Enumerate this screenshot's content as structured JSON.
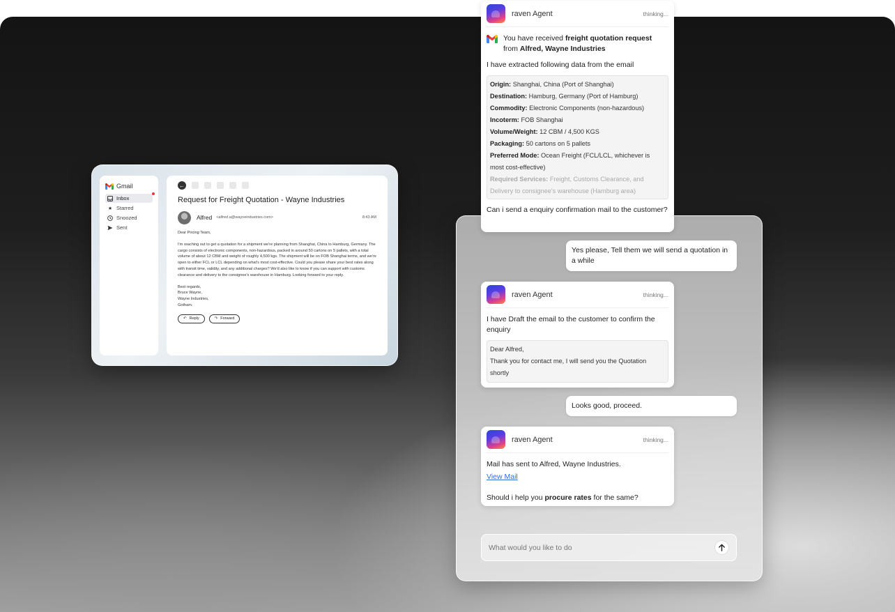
{
  "gmail": {
    "brand": "Gmail",
    "nav": [
      {
        "label": "Inbox",
        "icon": "inbox-icon"
      },
      {
        "label": "Starred",
        "icon": "star-icon"
      },
      {
        "label": "Snoozed",
        "icon": "clock-icon"
      },
      {
        "label": "Sent",
        "icon": "send-icon"
      }
    ],
    "subject": "Request for Freight Quotation - Wayne Industries",
    "sender_name": "Alfred",
    "sender_email": "<alfred.a@wayneindustries.com>",
    "time": "8:43 AM",
    "greeting": "Dear Pricing Team,",
    "body": "I'm reaching out to get a quotation for a shipment we're planning from Shanghai, China to Hamburg, Germany. The cargo consists of electronic components, non-hazardous, packed in around 50 cartons on 5 pallets, with a total volume of about 12 CBM and weight of roughly 4,500 kgs. The shipment will be on FOB Shanghai terms, and we're open to either FCL or LCL depending on what's most cost-effective. Could you please share your best rates along with transit time, validity, and any additional charges? We'd also like to know if you can support with customs clearance and delivery to the consignee's warehouse in Hamburg. Looking forward to your reply.",
    "sign_off": [
      "Best regards,",
      "Bruce Wayne,",
      "Wayne Industries,",
      "Gotham."
    ],
    "reply_label": "Reply",
    "forward_label": "Forward"
  },
  "chat": {
    "card1": {
      "agent_name": "raven Agent",
      "status": "thinking...",
      "intro_prefix": "You have received ",
      "intro_bold": "freight quotation request",
      "intro_from": "from ",
      "intro_from_bold": "Alfred, Wayne Industries",
      "extracted": "I have extracted following data from the email",
      "fields": [
        {
          "label": "Origin:",
          "value": "Shanghai, China (Port of Shanghai)"
        },
        {
          "label": "Destination:",
          "value": "Hamburg, Germany (Port of Hamburg)"
        },
        {
          "label": "Commodity:",
          "value": "Electronic Components (non-hazardous)"
        },
        {
          "label": "Incoterm:",
          "value": "FOB Shanghai"
        },
        {
          "label": "Volume/Weight:",
          "value": "12 CBM / 4,500 KGS"
        },
        {
          "label": "Packaging:",
          "value": "50 cartons on 5 pallets"
        },
        {
          "label": "Preferred Mode:",
          "value": "Ocean Freight (FCL/LCL, whichever is most cost-effective)"
        },
        {
          "label": "Required Services:",
          "value": "Freight, Customs Clearance, and Delivery to consignee's warehouse (Hamburg area)"
        }
      ],
      "question": "Can i send a enquiry confirmation mail to the customer?"
    },
    "user1": "Yes please, Tell them we will send a quotation in a while",
    "card2": {
      "agent_name": "raven Agent",
      "status": "thinking...",
      "text": "I have Draft the email to the customer to confirm the enquiry",
      "draft": [
        "Dear Alfred,",
        "Thank you for contact me, I will send you the Quotation shortly"
      ]
    },
    "user2": "Looks good, proceed.",
    "card3": {
      "agent_name": "raven Agent",
      "status": "thinking...",
      "sent": "Mail has sent to Alfred, Wayne Industries.",
      "link": "View Mail",
      "question_prefix": "Should i help you ",
      "question_bold": "procure rates",
      "question_suffix": " for the same?"
    },
    "input_placeholder": "What would you like to do"
  }
}
